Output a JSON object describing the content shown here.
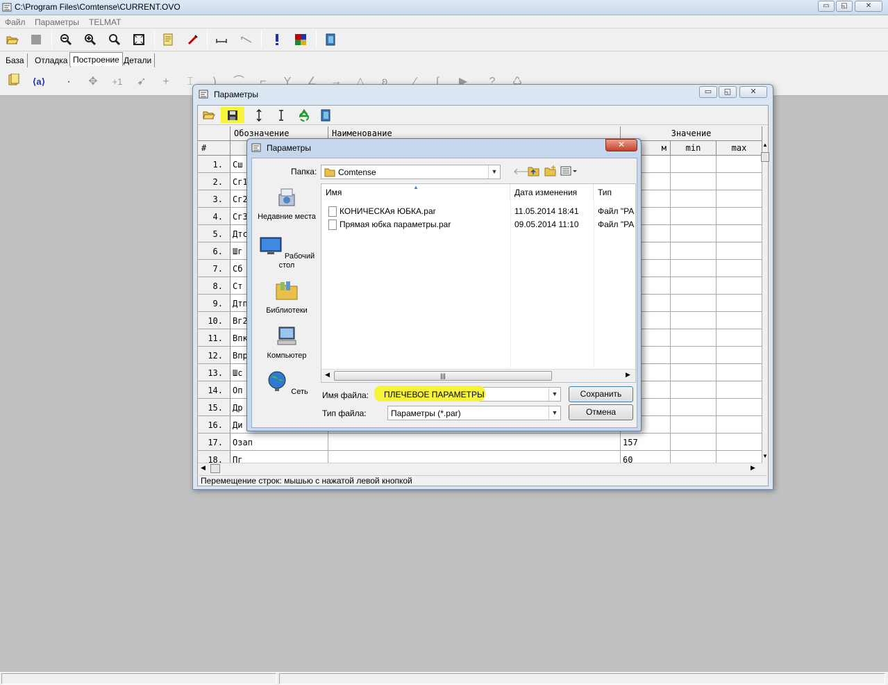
{
  "app": {
    "title": "C:\\Program Files\\Comtense\\CURRENT.OVO",
    "window_controls": {
      "minimize": "▭",
      "restore": "◱",
      "close": "✕"
    }
  },
  "menu": [
    "Файл",
    "Параметры",
    "TELMAT"
  ],
  "toolbar1": [
    "open-folder-icon",
    "stop-icon",
    "zoom-out-icon",
    "zoom-in-icon",
    "zoom-icon",
    "fit-icon",
    "note-icon",
    "pen-icon",
    "measure-icon",
    "measure-angle-icon",
    "exclamation-icon",
    "palette-icon",
    "exit-icon"
  ],
  "tabs": [
    "База",
    "Отладка",
    "Построение",
    "Детали"
  ],
  "tabs_active": "Построение",
  "params_window": {
    "title": "Параметры",
    "columns": {
      "num": "#",
      "designation": "Обозначение",
      "name": "Наименование",
      "value": "Значение",
      "unit_partial": "м",
      "min": "min",
      "max": "max"
    },
    "rows": [
      {
        "n": "1.",
        "code": "Сш",
        "value": ""
      },
      {
        "n": "2.",
        "code": "Сг1",
        "value": ""
      },
      {
        "n": "3.",
        "code": "Сг2",
        "value": ""
      },
      {
        "n": "4.",
        "code": "Сг3",
        "value": ""
      },
      {
        "n": "5.",
        "code": "Дтс",
        "value": ""
      },
      {
        "n": "6.",
        "code": "Шг",
        "value": ""
      },
      {
        "n": "7.",
        "code": "Сб",
        "value": ""
      },
      {
        "n": "8.",
        "code": "Ст",
        "value": ""
      },
      {
        "n": "9.",
        "code": "Дтп",
        "value": ""
      },
      {
        "n": "10.",
        "code": "Вг2",
        "value": ""
      },
      {
        "n": "11.",
        "code": "Впк",
        "value": ""
      },
      {
        "n": "12.",
        "code": "Впр",
        "value": ""
      },
      {
        "n": "13.",
        "code": "Шс",
        "value": ""
      },
      {
        "n": "14.",
        "code": "Оп",
        "value": ""
      },
      {
        "n": "15.",
        "code": "Др",
        "value": ""
      },
      {
        "n": "16.",
        "code": "Ди",
        "value": ""
      },
      {
        "n": "17.",
        "code": "Озап",
        "value": "157"
      },
      {
        "n": "18.",
        "code": "Пг",
        "value": "60"
      }
    ],
    "status": "Перемещение строк: мышью с нажатой левой кнопкой"
  },
  "save_dialog": {
    "title": "Параметры",
    "close": "✕",
    "folder_label": "Папка:",
    "folder_value": "Comtense",
    "places": [
      {
        "label": "Недавние места",
        "icon": "recent-places-icon"
      },
      {
        "label": "Рабочий стол",
        "icon": "desktop-icon"
      },
      {
        "label": "Библиотеки",
        "icon": "libraries-icon"
      },
      {
        "label": "Компьютер",
        "icon": "computer-icon"
      },
      {
        "label": "Сеть",
        "icon": "network-icon"
      }
    ],
    "list_headers": {
      "name": "Имя",
      "date": "Дата изменения",
      "type": "Тип"
    },
    "files": [
      {
        "name": "КОНИЧЕСКАя ЮБКА.par",
        "date": "11.05.2014 18:41",
        "type": "Файл \"PA"
      },
      {
        "name": "Прямая юбка параметры.par",
        "date": "09.05.2014 11:10",
        "type": "Файл \"PA"
      }
    ],
    "filename_label": "Имя файла:",
    "filename_value": "ПЛЕЧЕВОЕ ПАРАМЕТРЫ",
    "filetype_label": "Тип файла:",
    "filetype_value": "Параметры (*.par)",
    "save_button": "Сохранить",
    "cancel_button": "Отмена",
    "highlight_color": "#f7f23a"
  }
}
